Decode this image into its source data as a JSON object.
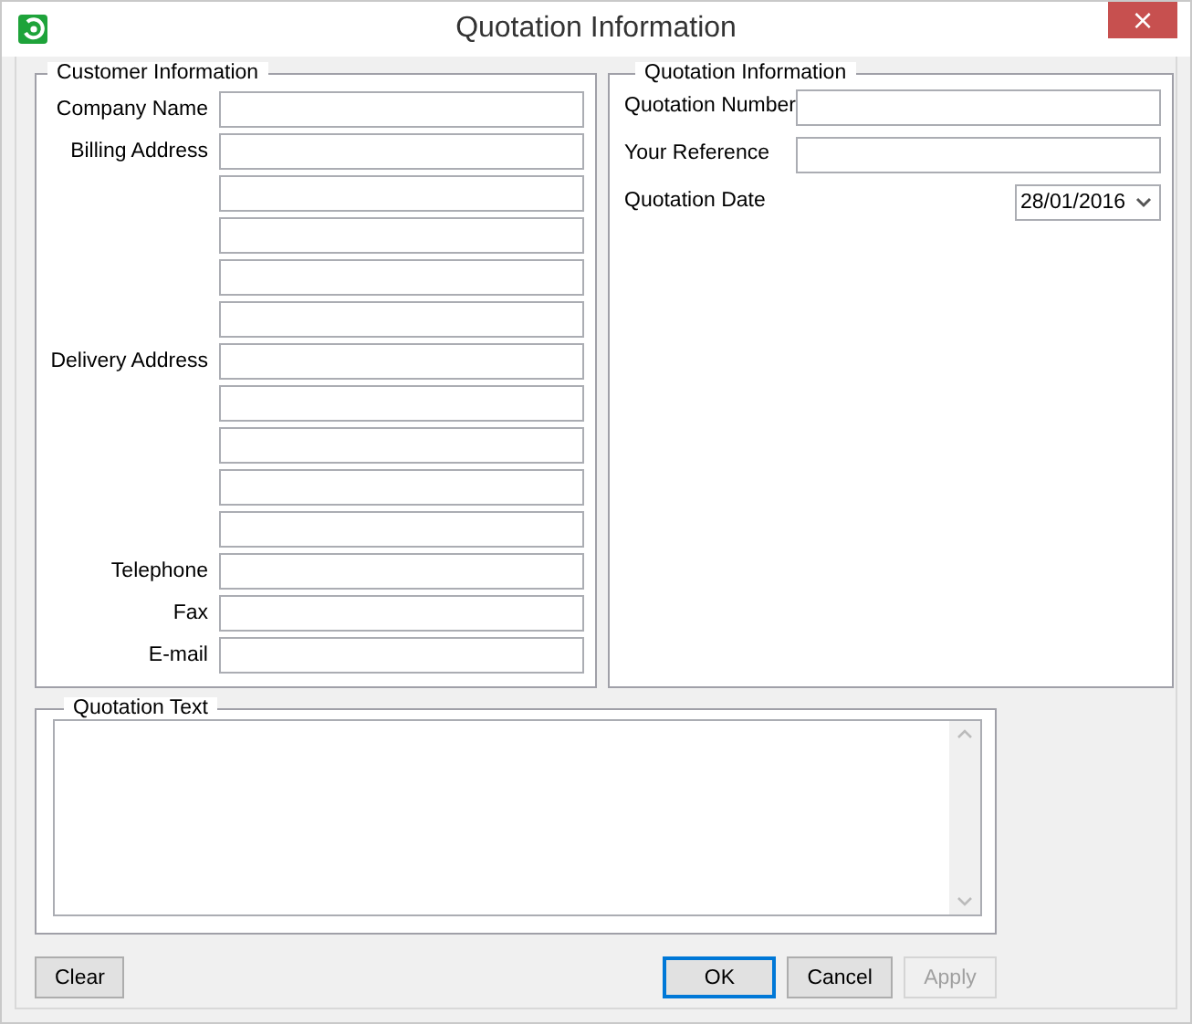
{
  "window": {
    "title": "Quotation Information",
    "close": "×"
  },
  "customer_information": {
    "title": "Customer Information",
    "fields": [
      {
        "kind": "labeled",
        "label": "Company Name"
      },
      {
        "kind": "labeled",
        "label": "Billing Address"
      },
      {
        "kind": "continuation"
      },
      {
        "kind": "continuation"
      },
      {
        "kind": "continuation"
      },
      {
        "kind": "continuation"
      },
      {
        "kind": "labeled",
        "label": "Delivery Address"
      },
      {
        "kind": "continuation"
      },
      {
        "kind": "continuation"
      },
      {
        "kind": "continuation"
      },
      {
        "kind": "continuation"
      },
      {
        "kind": "labeled",
        "label": "Telephone"
      },
      {
        "kind": "labeled",
        "label": "Fax"
      },
      {
        "kind": "labeled",
        "label": "E-mail"
      }
    ]
  },
  "quotation_information": {
    "title": "Quotation Information",
    "fields": [
      {
        "kind": "text",
        "label": "Quotation Number"
      },
      {
        "kind": "text",
        "label": "Your Reference"
      },
      {
        "kind": "date",
        "label": "Quotation Date",
        "value": "28/01/2016"
      }
    ]
  },
  "quotation_text": {
    "title": "Quotation Text"
  },
  "buttons": [
    {
      "label": "Clear",
      "focused": false,
      "disabled": false
    },
    {
      "label": "OK",
      "focused": true,
      "disabled": false
    },
    {
      "label": "Cancel",
      "focused": false,
      "disabled": false
    },
    {
      "label": "Apply",
      "focused": false,
      "disabled": true
    }
  ]
}
